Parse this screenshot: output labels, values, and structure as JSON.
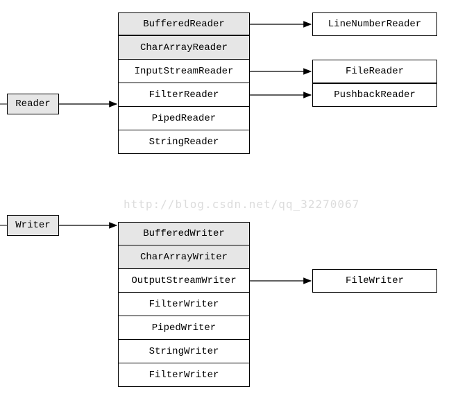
{
  "reader": {
    "root": "Reader",
    "subclasses": [
      "BufferedReader",
      "CharArrayReader",
      "InputStreamReader",
      "FilterReader",
      "PipedReader",
      "StringReader"
    ],
    "leaf": {
      "bufferedReader": "LineNumberReader",
      "inputStreamReader": "FileReader",
      "filterReader": "PushbackReader"
    }
  },
  "writer": {
    "root": "Writer",
    "subclasses": [
      "BufferedWriter",
      "CharArrayWriter",
      "OutputStreamWriter",
      "FilterWriter",
      "PipedWriter",
      "StringWriter",
      "FilterWriter"
    ],
    "leaf": {
      "outputStreamWriter": "FileWriter"
    }
  },
  "watermark": "http://blog.csdn.net/qq_32270067",
  "chart_data": {
    "type": "tree",
    "title": "Java Reader/Writer class hierarchy",
    "nodes": [
      {
        "id": "Reader",
        "shaded": true
      },
      {
        "id": "BufferedReader",
        "parent": "Reader",
        "shaded": true
      },
      {
        "id": "CharArrayReader",
        "parent": "Reader",
        "shaded": true
      },
      {
        "id": "InputStreamReader",
        "parent": "Reader",
        "shaded": false
      },
      {
        "id": "FilterReader",
        "parent": "Reader",
        "shaded": false
      },
      {
        "id": "PipedReader",
        "parent": "Reader",
        "shaded": false
      },
      {
        "id": "StringReader",
        "parent": "Reader",
        "shaded": false
      },
      {
        "id": "LineNumberReader",
        "parent": "BufferedReader",
        "shaded": false
      },
      {
        "id": "FileReader",
        "parent": "InputStreamReader",
        "shaded": false
      },
      {
        "id": "PushbackReader",
        "parent": "FilterReader",
        "shaded": false
      },
      {
        "id": "Writer",
        "shaded": true
      },
      {
        "id": "BufferedWriter",
        "parent": "Writer",
        "shaded": true
      },
      {
        "id": "CharArrayWriter",
        "parent": "Writer",
        "shaded": true
      },
      {
        "id": "OutputStreamWriter",
        "parent": "Writer",
        "shaded": false
      },
      {
        "id": "FilterWriter",
        "parent": "Writer",
        "shaded": false
      },
      {
        "id": "PipedWriter",
        "parent": "Writer",
        "shaded": false
      },
      {
        "id": "StringWriter",
        "parent": "Writer",
        "shaded": false
      },
      {
        "id": "FilterWriter_2",
        "label": "FilterWriter",
        "parent": "Writer",
        "shaded": false
      },
      {
        "id": "FileWriter",
        "parent": "OutputStreamWriter",
        "shaded": false
      }
    ]
  }
}
